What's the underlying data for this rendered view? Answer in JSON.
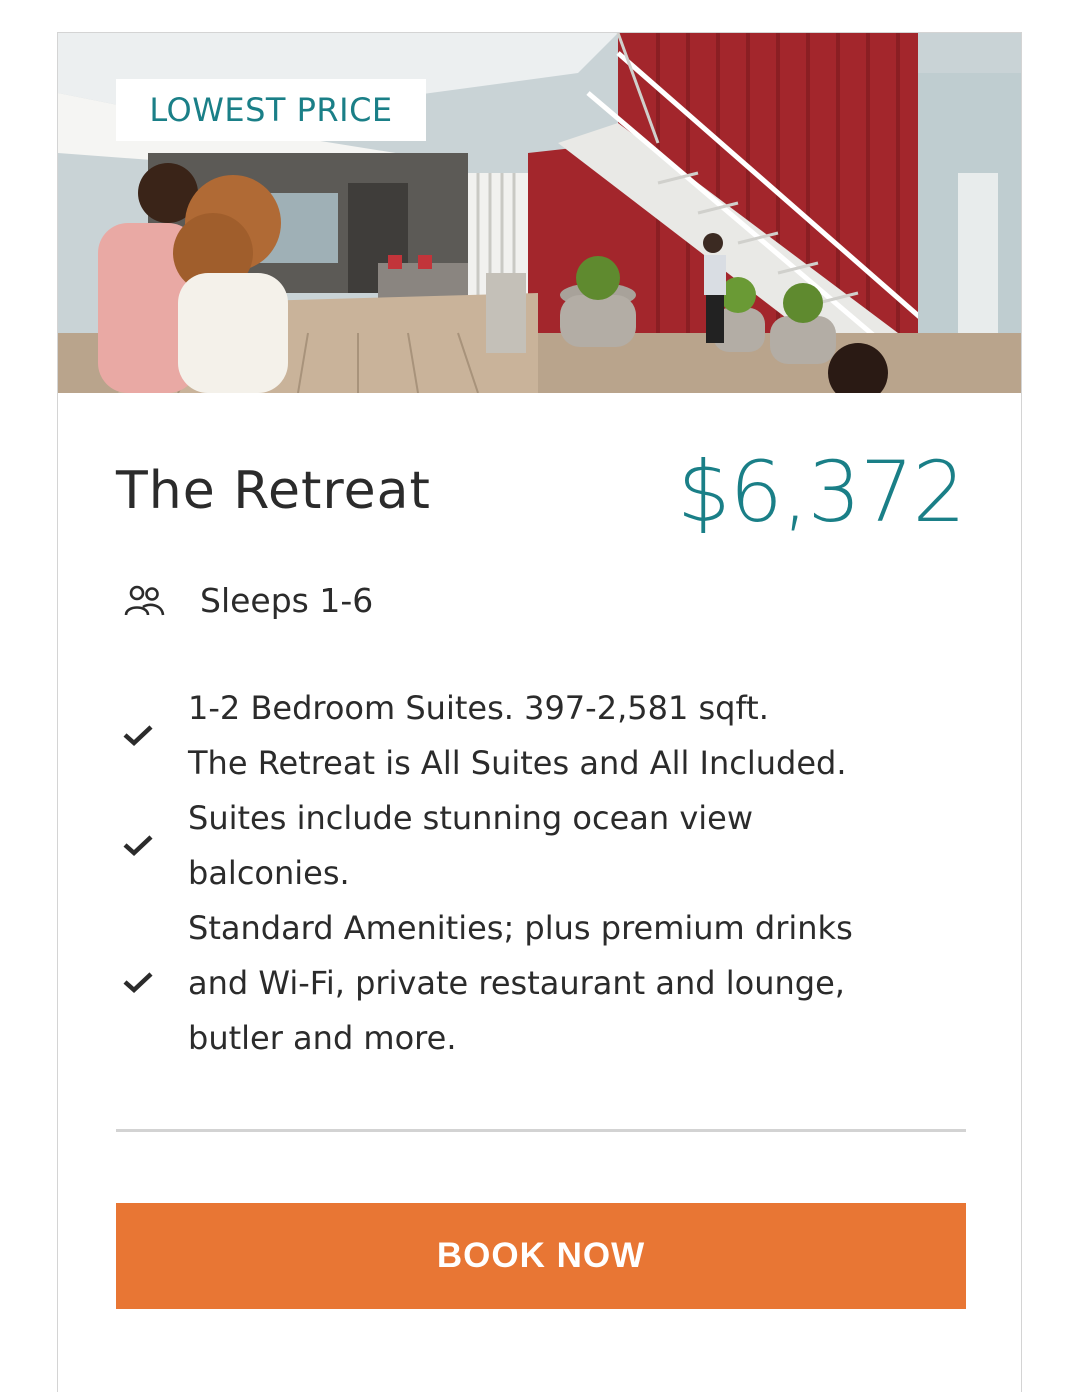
{
  "badge": {
    "label": "LOWEST PRICE"
  },
  "suite": {
    "title": "The Retreat",
    "price": "$6,372",
    "sleeps": "Sleeps 1-6",
    "icons": {
      "guests": "people-icon",
      "bullet": "check-icon"
    }
  },
  "features": [
    {
      "text": "1-2 Bedroom Suites. 397-2,581 sqft.\nThe Retreat is All Suites and All Included."
    },
    {
      "text": "Suites include stunning ocean view\nbalconies."
    },
    {
      "text": "Standard Amenities; plus premium drinks\nand Wi-Fi, private restaurant and lounge,\nbutler and more."
    }
  ],
  "cta": {
    "label": "BOOK NOW"
  },
  "colors": {
    "accent": "#1a7f87",
    "cta": "#e87634"
  }
}
